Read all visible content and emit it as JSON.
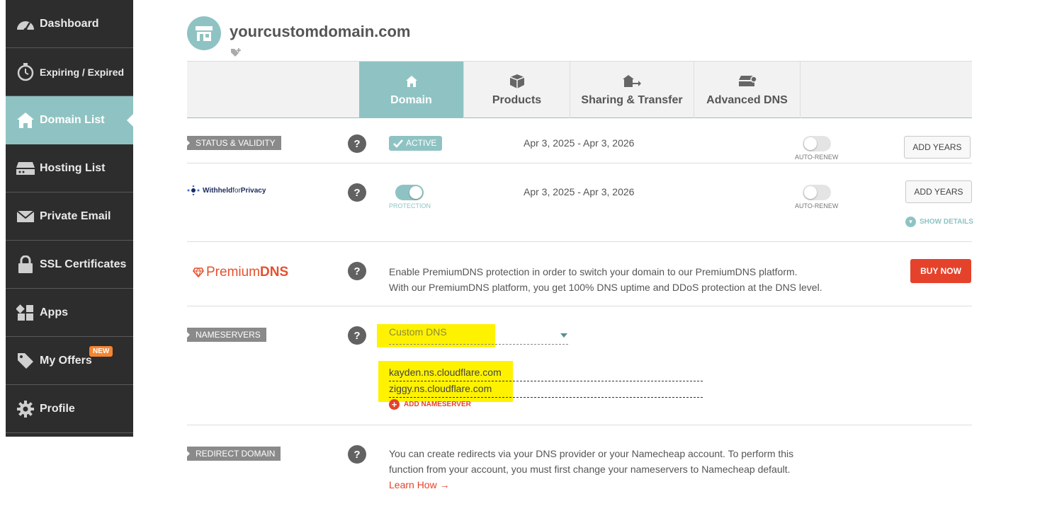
{
  "sidebar": {
    "items": [
      {
        "label": "Dashboard",
        "icon": "dashboard-icon"
      },
      {
        "label": "Expiring / Expired",
        "icon": "stopwatch-icon"
      },
      {
        "label": "Domain List",
        "icon": "home-icon",
        "active": true
      },
      {
        "label": "Hosting List",
        "icon": "server-icon"
      },
      {
        "label": "Private Email",
        "icon": "envelope-icon"
      },
      {
        "label": "SSL Certificates",
        "icon": "lock-icon"
      },
      {
        "label": "Apps",
        "icon": "apps-grid-icon"
      },
      {
        "label": "My Offers",
        "icon": "tag-icon",
        "badge": "NEW"
      },
      {
        "label": "Profile",
        "icon": "gear-icon"
      }
    ]
  },
  "header": {
    "domain": "yourcustomdomain.com"
  },
  "tabs": [
    {
      "label": "Domain",
      "icon": "home-icon",
      "active": true
    },
    {
      "label": "Products",
      "icon": "box-icon"
    },
    {
      "label": "Sharing & Transfer",
      "icon": "transfer-icon"
    },
    {
      "label": "Advanced DNS",
      "icon": "dns-server-icon"
    }
  ],
  "status": {
    "label": "STATUS & VALIDITY",
    "badge": "ACTIVE",
    "dates": "Apr 3, 2025 - Apr 3, 2026",
    "auto_renew_label": "AUTO-RENEW",
    "auto_renew": false,
    "button": "ADD YEARS"
  },
  "privacy": {
    "logo_text_a": "Withheld",
    "logo_text_b": "for",
    "logo_text_c": "Privacy",
    "protection_label": "PROTECTION",
    "protection": true,
    "dates": "Apr 3, 2025 - Apr 3, 2026",
    "auto_renew_label": "AUTO-RENEW",
    "auto_renew": false,
    "button": "ADD YEARS",
    "show_details": "SHOW DETAILS"
  },
  "premium": {
    "logo_a": "Premium",
    "logo_b": "DNS",
    "line1": "Enable PremiumDNS protection in order to switch your domain to our PremiumDNS platform.",
    "line2": "With our PremiumDNS platform, you get 100% DNS uptime and DDoS protection at the DNS level.",
    "button": "BUY NOW"
  },
  "nameservers": {
    "label": "NAMESERVERS",
    "selected": "Custom DNS",
    "entries": [
      "kayden.ns.cloudflare.com",
      "ziggy.ns.cloudflare.com"
    ],
    "add_label": "ADD NAMESERVER"
  },
  "redirect": {
    "label": "REDIRECT DOMAIN",
    "line1": "You can create redirects via your DNS provider or your Namecheap account. To perform this",
    "line2": "function from your account, you must first change your nameservers to Namecheap default.",
    "link": "Learn How →"
  },
  "help_glyph": "?",
  "colors": {
    "teal": "#8fc3c3",
    "sidebar": "#2d2d2d",
    "accent_red": "#e5422b",
    "highlight": "#fff200",
    "badge_orange": "#f58530"
  }
}
